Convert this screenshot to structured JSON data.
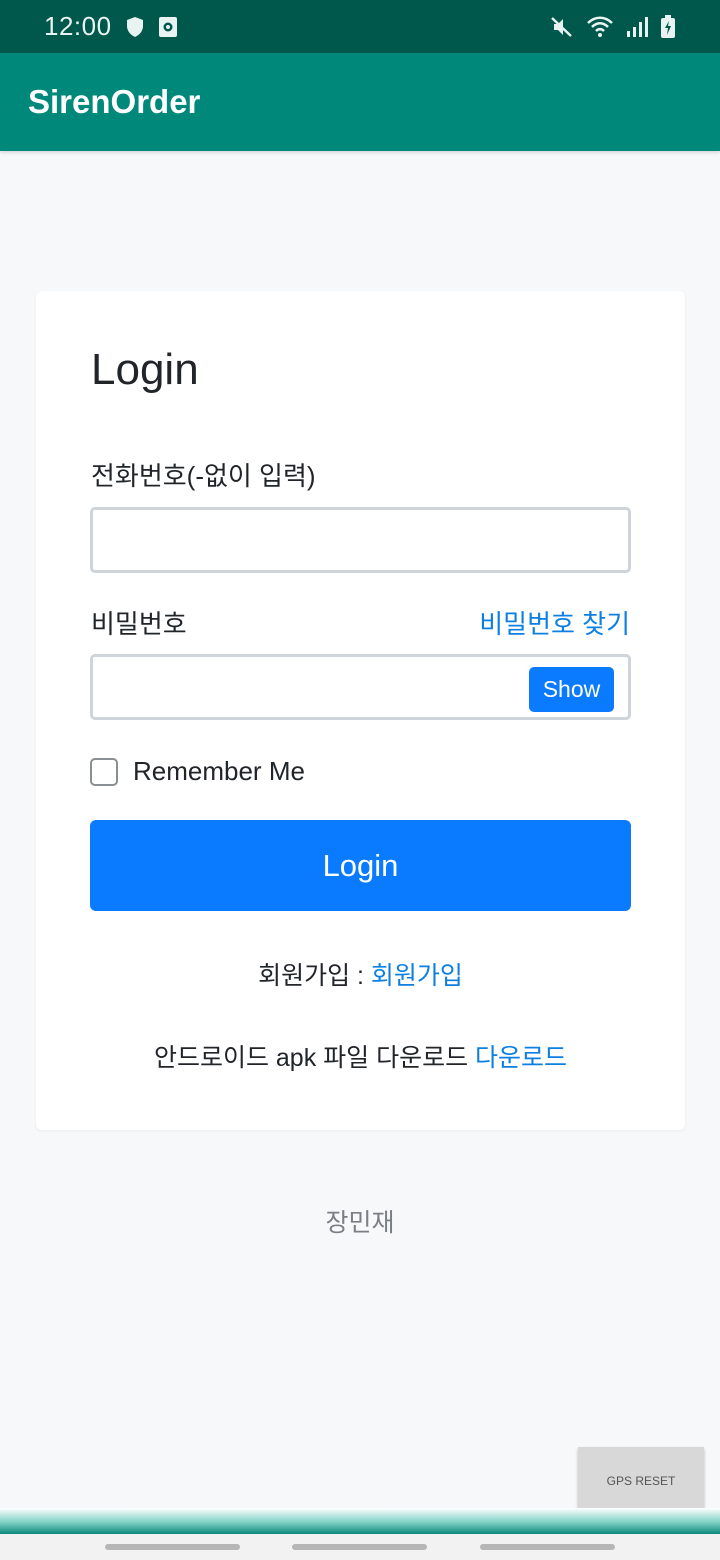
{
  "status_bar": {
    "time": "12:00",
    "icons": [
      "shield-icon",
      "screen-record-icon",
      "mute-icon",
      "wifi-icon",
      "signal-icon",
      "battery-charging-icon"
    ]
  },
  "app_bar": {
    "title": "SirenOrder"
  },
  "login_form": {
    "heading": "Login",
    "phone_label": "전화번호(-없이 입력)",
    "phone_value": "",
    "password_label": "비밀번호",
    "find_password_link": "비밀번호 찾기",
    "password_value": "",
    "show_button": "Show",
    "remember_me": "Remember Me",
    "login_button": "Login",
    "signup_prefix": "회원가입 : ",
    "signup_link": "회원가입",
    "download_prefix": "안드로이드 apk 파일 다운로드 ",
    "download_link": "다운로드"
  },
  "footer": {
    "name": "장민재"
  },
  "floating": {
    "gps_reset": "GPS RESET"
  },
  "colors": {
    "status_bar": "#00574b",
    "app_bar": "#00897b",
    "primary_button": "#0a7bff",
    "link": "#0d7fe0"
  }
}
